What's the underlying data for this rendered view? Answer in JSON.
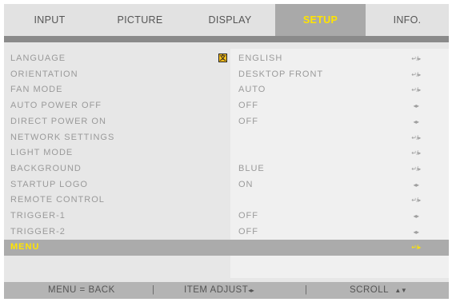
{
  "tabs": [
    {
      "label": "INPUT"
    },
    {
      "label": "PICTURE"
    },
    {
      "label": "DISPLAY"
    },
    {
      "label": "SETUP"
    },
    {
      "label": "INFO."
    }
  ],
  "menu": {
    "rows": [
      {
        "label": "LANGUAGE",
        "value": "ENGLISH",
        "nav": "↵/▸"
      },
      {
        "label": "ORIENTATION",
        "value": "DESKTOP  FRONT",
        "nav": "↵/▸"
      },
      {
        "label": "FAN  MODE",
        "value": "AUTO",
        "nav": "↵/▸"
      },
      {
        "label": "AUTO  POWER  OFF",
        "value": "OFF",
        "nav": "◂▸"
      },
      {
        "label": "DIRECT  POWER  ON",
        "value": "OFF",
        "nav": "◂▸"
      },
      {
        "label": "NETWORK  SETTINGS",
        "value": "",
        "nav": "↵/▸"
      },
      {
        "label": "LIGHT  MODE",
        "value": "",
        "nav": "↵/▸"
      },
      {
        "label": "BACKGROUND",
        "value": "BLUE",
        "nav": "↵/▸"
      },
      {
        "label": "STARTUP  LOGO",
        "value": "ON",
        "nav": "◂▸"
      },
      {
        "label": "REMOTE  CONTROL",
        "value": "",
        "nav": "↵/▸"
      },
      {
        "label": "TRIGGER-1",
        "value": "OFF",
        "nav": "◂▸"
      },
      {
        "label": "TRIGGER-2",
        "value": "OFF",
        "nav": "◂▸"
      },
      {
        "label": "MENU",
        "value": "",
        "nav": "↵/▸"
      }
    ]
  },
  "footer": {
    "back": "MENU  =  BACK",
    "sep1": "|",
    "adjust": "ITEM  ADJUST",
    "adjust_arrows": "◂▸",
    "sep2": "|",
    "scroll": "SCROLL",
    "scroll_arrows": "▲▼"
  },
  "colors": {
    "active_tab_text": "#ffe400",
    "selected_row_bg": "#ababab",
    "lang_icon": "#ffc21a"
  },
  "icons": {
    "language": "language-globe-icon"
  }
}
